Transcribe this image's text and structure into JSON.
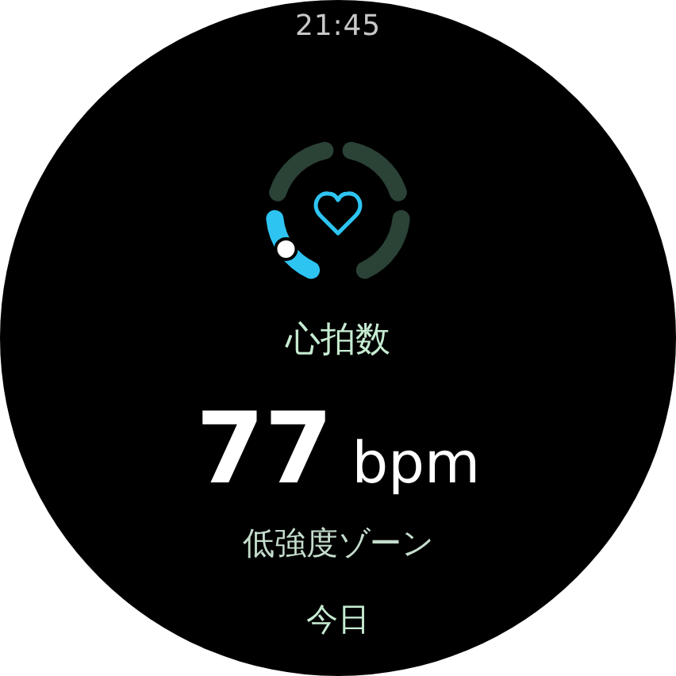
{
  "status_bar": {
    "time": "21:45"
  },
  "gauge": {
    "zones": [
      {
        "active": true
      },
      {
        "active": false
      },
      {
        "active": false
      },
      {
        "active": false
      }
    ]
  },
  "title": "心拍数",
  "reading": {
    "value": "77",
    "unit": "bpm"
  },
  "zone_label": "低強度ゾーン",
  "next_section": "今日"
}
